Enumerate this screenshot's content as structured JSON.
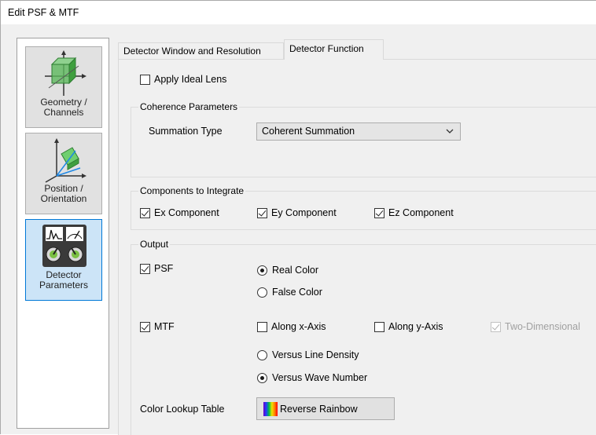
{
  "window": {
    "title": "Edit PSF & MTF"
  },
  "nav": {
    "items": [
      {
        "label": "Geometry / Channels",
        "line1": "Geometry /",
        "line2": "Channels",
        "icon": "geometry-cube-icon",
        "selected": false
      },
      {
        "label": "Position / Orientation",
        "line1": "Position /",
        "line2": "Orientation",
        "icon": "position-axes-icon",
        "selected": false
      },
      {
        "label": "Detector Parameters",
        "line1": "Detector",
        "line2": "Parameters",
        "icon": "detector-meter-icon",
        "selected": true
      }
    ]
  },
  "tabs": [
    {
      "label": "Detector Window and Resolution",
      "active": false
    },
    {
      "label": "Detector Function",
      "active": true
    }
  ],
  "apply_ideal_lens": {
    "label": "Apply Ideal Lens",
    "checked": false
  },
  "coherence": {
    "title": "Coherence Parameters",
    "summation_label": "Summation Type",
    "summation_value": "Coherent Summation"
  },
  "components": {
    "title": "Components to Integrate",
    "ex": {
      "label": "Ex Component",
      "checked": true
    },
    "ey": {
      "label": "Ey Component",
      "checked": true
    },
    "ez": {
      "label": "Ez Component",
      "checked": true
    }
  },
  "output": {
    "title": "Output",
    "psf": {
      "label": "PSF",
      "checked": true
    },
    "real_color": {
      "label": "Real Color",
      "selected": true
    },
    "false_color": {
      "label": "False Color",
      "selected": false
    },
    "mtf": {
      "label": "MTF",
      "checked": true
    },
    "along_x": {
      "label": "Along x-Axis",
      "checked": false
    },
    "along_y": {
      "label": "Along y-Axis",
      "checked": false
    },
    "two_dim": {
      "label": "Two-Dimensional",
      "checked": true,
      "disabled": true
    },
    "versus_line": {
      "label": "Versus Line Density",
      "selected": false
    },
    "versus_wave": {
      "label": "Versus Wave Number",
      "selected": true
    },
    "lookup_label": "Color Lookup Table",
    "lookup_button": "Reverse Rainbow"
  },
  "colors": {
    "selected_nav_bg": "#cce4f7",
    "selected_nav_border": "#0078d7",
    "window_bg": "#f0f0f0"
  }
}
